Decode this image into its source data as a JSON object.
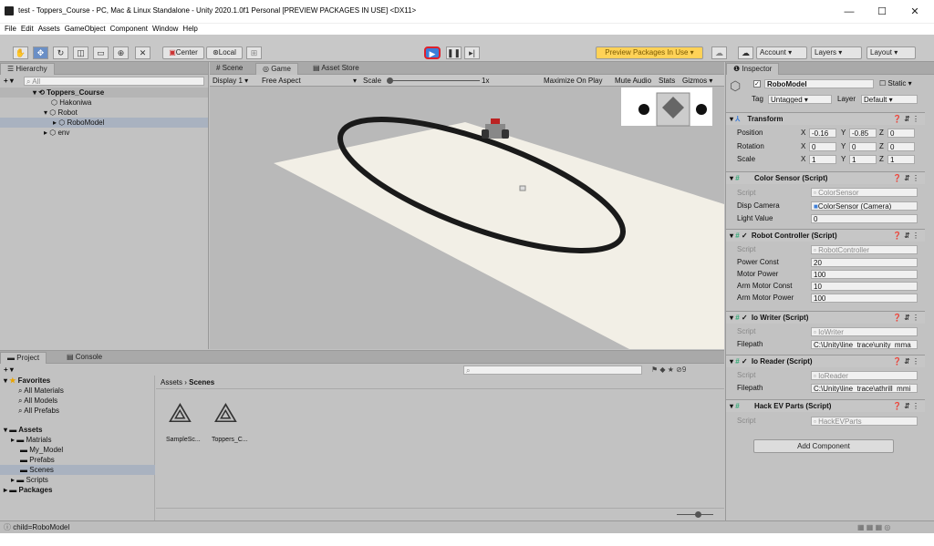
{
  "window": {
    "title": "test - Toppers_Course - PC, Mac & Linux Standalone - Unity 2020.1.0f1 Personal [PREVIEW PACKAGES IN USE] <DX11>",
    "min": "—",
    "max": "☐",
    "close": "✕"
  },
  "menu": [
    "File",
    "Edit",
    "Assets",
    "GameObject",
    "Component",
    "Window",
    "Help"
  ],
  "toolbar": {
    "center": "Center",
    "local": "Local",
    "preview": "Preview Packages In Use ▾",
    "account": "Account",
    "layers": "Layers",
    "layout": "Layout"
  },
  "hierarchy": {
    "tab": "Hierarchy",
    "search": "All",
    "scene": "Toppers_Course",
    "items": [
      "Hakoniwa",
      "Robot",
      "RoboModel",
      "env"
    ]
  },
  "game": {
    "tabs": [
      "Scene",
      "Game",
      "Asset Store"
    ],
    "display": "Display 1",
    "aspect": "Free Aspect",
    "scale_label": "Scale",
    "scale_value": "1x",
    "opts": [
      "Maximize On Play",
      "Mute Audio",
      "Stats",
      "Gizmos"
    ]
  },
  "inspector": {
    "tab": "Inspector",
    "name": "RoboModel",
    "static": "Static",
    "tag_label": "Tag",
    "tag": "Untagged",
    "layer_label": "Layer",
    "layer": "Default",
    "transform": {
      "title": "Transform",
      "position": "Position",
      "rotation": "Rotation",
      "scale": "Scale",
      "pos": [
        "-0.16",
        "-0.85",
        "0"
      ],
      "rot": [
        "0",
        "0",
        "0"
      ],
      "scl": [
        "1",
        "1",
        "1"
      ],
      "axes": [
        "X",
        "Y",
        "Z"
      ]
    },
    "color_sensor": {
      "title": "Color Sensor (Script)",
      "script_label": "Script",
      "script": "ColorSensor",
      "cam_label": "Disp Camera",
      "cam": "ColorSensor (Camera)",
      "light_label": "Light Value",
      "light": "0"
    },
    "robot_ctrl": {
      "title": "Robot Controller (Script)",
      "script_label": "Script",
      "script": "RobotController",
      "rows": [
        [
          "Power Const",
          "20"
        ],
        [
          "Motor Power",
          "100"
        ],
        [
          "Arm Motor Const",
          "10"
        ],
        [
          "Arm Motor Power",
          "100"
        ]
      ]
    },
    "io_writer": {
      "title": "Io Writer (Script)",
      "script_label": "Script",
      "script": "IoWriter",
      "fp_label": "Filepath",
      "fp": "C:\\Unity\\line_trace\\unity_mma"
    },
    "io_reader": {
      "title": "Io Reader (Script)",
      "script_label": "Script",
      "script": "IoReader",
      "fp_label": "Filepath",
      "fp": "C:\\Unity\\line_trace\\athrill_mmi"
    },
    "hack": {
      "title": "Hack EV Parts (Script)",
      "script_label": "Script",
      "script": "HackEVParts"
    },
    "add": "Add Component"
  },
  "project": {
    "tabs": [
      "Project",
      "Console"
    ],
    "favorites": "Favorites",
    "fav_items": [
      "All Materials",
      "All Models",
      "All Prefabs"
    ],
    "assets": "Assets",
    "asset_items": [
      "Matrials",
      "My_Model",
      "Prefabs",
      "Scenes",
      "Scripts"
    ],
    "packages": "Packages",
    "crumb_root": "Assets",
    "crumb_leaf": "Scenes",
    "files": [
      "SampleSc...",
      "Toppers_C..."
    ],
    "hidden_count": "9"
  },
  "status": {
    "text": "child=RoboModel"
  },
  "colors": {
    "accent": "#3d7ed8",
    "play_highlight": "#e0202a",
    "preview": "#ffd257"
  }
}
